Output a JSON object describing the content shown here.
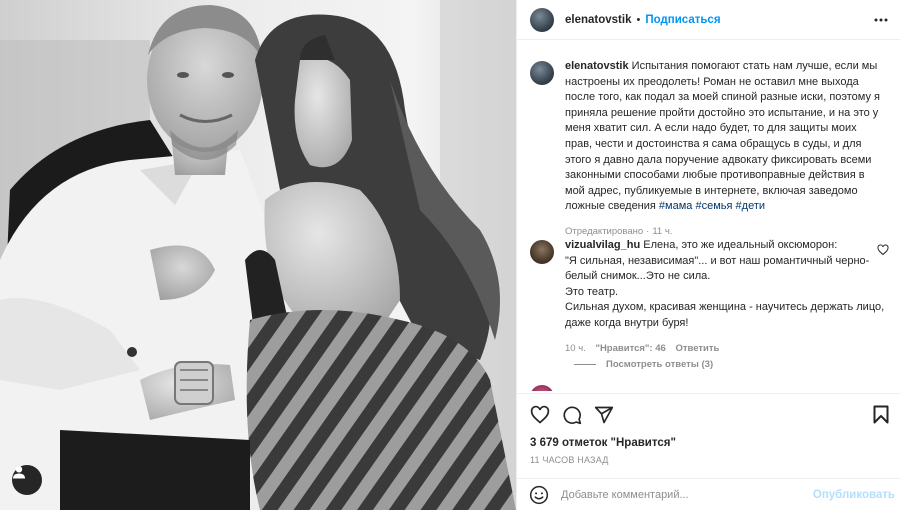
{
  "post": {
    "username": "elenatovstik",
    "follow_label": "Подписаться",
    "header_dot": "•",
    "caption": {
      "username": "elenatovstik",
      "text": "Испытания помогают стать нам лучше, если мы настроены их преодолеть! Роман не оставил мне выхода после того, как подал за моей спиной разные иски, поэтому я приняла решение пройти достойно это испытание, и на это у меня хватит сил. А если надо будет, то для защиты моих прав, чести и достоинства я сама обращусь в суды, и для этого я давно дала поручение адвокату фиксировать всеми законными способами любые противоправные действия в мой адрес, публикуемые в интернете, включая заведомо ложные сведения",
      "hashtags": [
        "#мама",
        "#семья",
        "#дети"
      ],
      "edited_label": "Отредактировано",
      "meta_dot": "·",
      "time": "11 ч."
    },
    "comments": [
      {
        "username": "vizualvilag_hu",
        "text_lines": [
          "Елена, это же идеальный оксюморон:",
          "\"Я сильная, независимая\"... и вот наш романтичный черно-белый снимок...Это не сила.",
          "Это театр.",
          "Сильная духом, красивая женщина - научитесь держать лицо, даже когда внутри буря!"
        ],
        "time": "10 ч.",
        "likes_label": "\"Нравится\": 46",
        "reply_label": "Ответить",
        "view_replies": "Посмотреть ответы (3)"
      }
    ],
    "likes_count": "3 679 отметок \"Нравится\"",
    "time_ago": "11 ЧАСОВ НАЗАД",
    "add_comment_placeholder": "Добавьте комментарий...",
    "publish_label": "Опубликовать"
  },
  "colors": {
    "link": "#0095f6",
    "hashtag": "#00376b",
    "muted": "#8e8e8e",
    "publish_disabled": "#b2dffc",
    "border": "#efefef"
  },
  "icons": {
    "more": "more-horizontal-icon",
    "heart": "heart-icon",
    "comment": "comment-icon",
    "share": "share-icon",
    "bookmark": "bookmark-icon",
    "emoji": "emoji-icon",
    "user_tag": "user-icon"
  }
}
